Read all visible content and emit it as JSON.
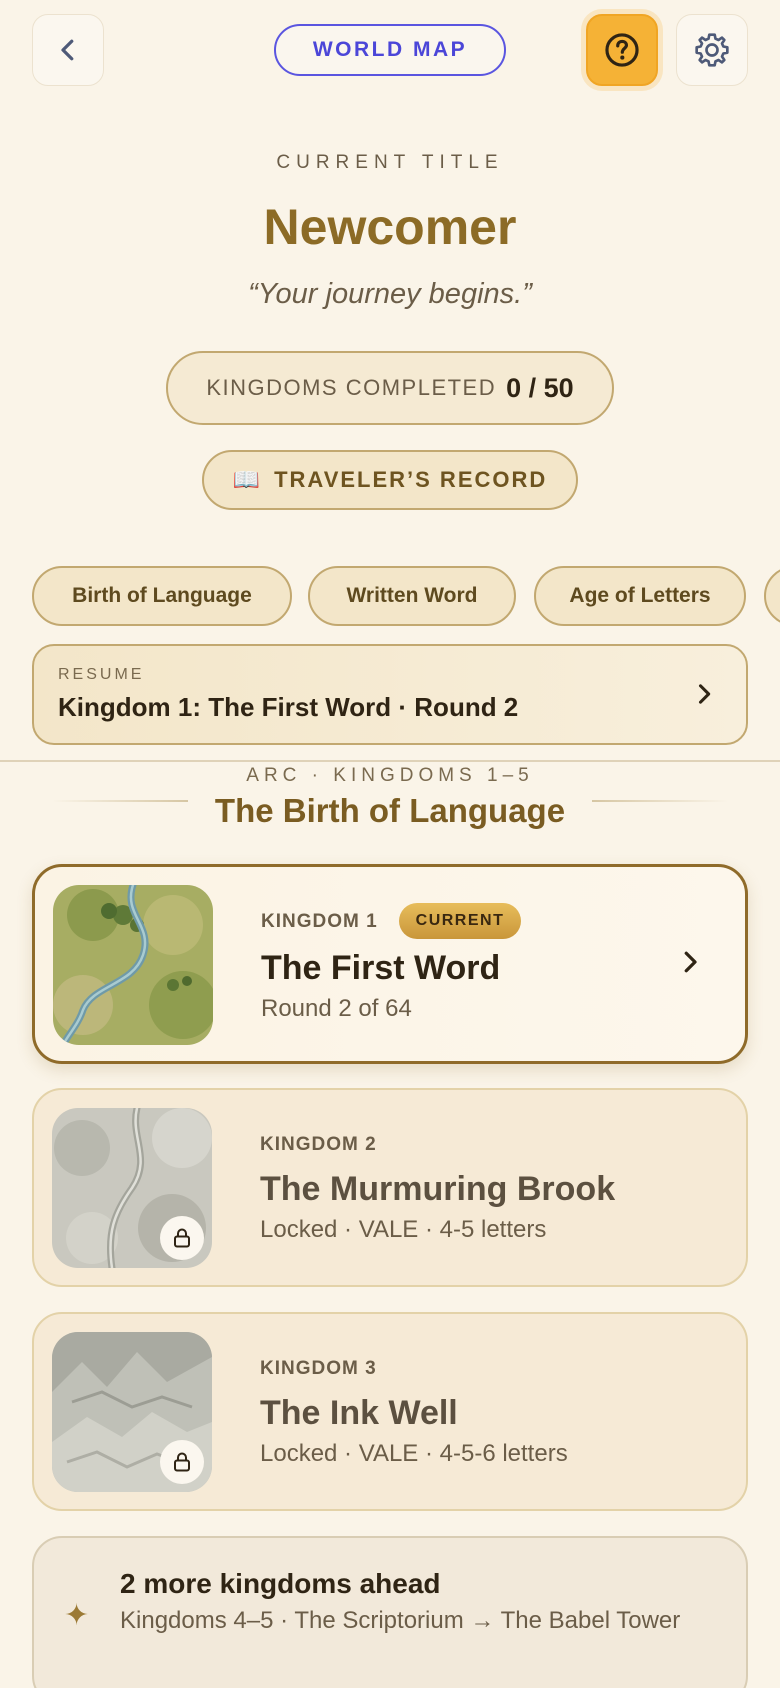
{
  "header": {
    "back_icon": "chevron-left-icon",
    "world_map_label": "WORLD MAP",
    "help_icon": "question-circle-icon",
    "settings_icon": "gear-icon"
  },
  "hero": {
    "current_title_label": "CURRENT TITLE",
    "title": "Newcomer",
    "tagline": "“Your journey begins.”",
    "kingdoms_label": "KINGDOMS COMPLETED",
    "kingdoms_value": "0 / 50",
    "record_icon": "book-icon",
    "record_label": "TRAVELER’S RECORD"
  },
  "arc_chips": [
    {
      "label": "Birth of Language"
    },
    {
      "label": "Written Word"
    },
    {
      "label": "Age of Letters"
    }
  ],
  "resume": {
    "label": "RESUME",
    "text": "Kingdom 1: The First Word · Round 2"
  },
  "arc": {
    "label": "ARC · KINGDOMS 1–5",
    "title": "The Birth of Language"
  },
  "kingdoms": [
    {
      "label": "KINGDOM 1",
      "badge": "CURRENT",
      "title": "The First Word",
      "subtitle": "Round 2 of 64",
      "status": "current"
    },
    {
      "label": "KINGDOM 2",
      "title": "The Murmuring Brook",
      "subtitle": "Locked · VALE · 4-5 letters",
      "status": "locked"
    },
    {
      "label": "KINGDOM 3",
      "title": "The Ink Well",
      "subtitle": "Locked · VALE · 4-5-6 letters",
      "status": "locked"
    }
  ],
  "more": {
    "icon": "sparkle-icon",
    "title": "2 more kingdoms ahead",
    "subtitle": "Kingdoms 4–5 · The Scriptorium → The Babel Tower"
  },
  "colors": {
    "background": "#faf4e8",
    "accent_gold": "#8c6b26",
    "world_map_blue": "#4b46d8",
    "help_yellow": "#f5b236"
  }
}
